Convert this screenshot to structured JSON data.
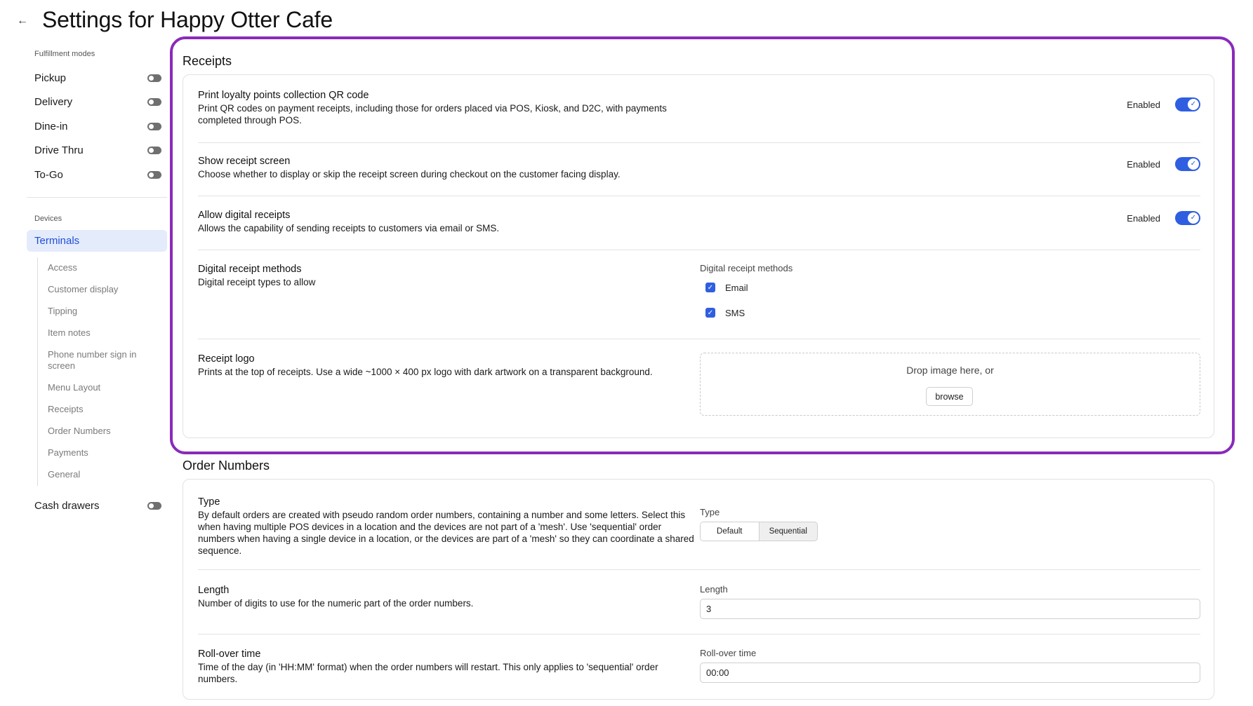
{
  "header": {
    "back_icon": "arrow-left-icon",
    "title": "Settings for Happy Otter Cafe"
  },
  "sidebar": {
    "fulfillment_label": "Fulfillment modes",
    "modes": [
      {
        "label": "Pickup"
      },
      {
        "label": "Delivery"
      },
      {
        "label": "Dine-in"
      },
      {
        "label": "Drive Thru"
      },
      {
        "label": "To-Go"
      }
    ],
    "devices_label": "Devices",
    "terminals_label": "Terminals",
    "terminal_subitems": [
      "Access",
      "Customer display",
      "Tipping",
      "Item notes",
      "Phone number sign in screen",
      "Menu Layout",
      "Receipts",
      "Order Numbers",
      "Payments",
      "General"
    ],
    "cash_drawers_label": "Cash drawers"
  },
  "receipts": {
    "title": "Receipts",
    "rows": [
      {
        "title": "Print loyalty points collection QR code",
        "desc": "Print QR codes on payment receipts, including those for orders placed via POS, Kiosk, and D2C, with payments completed through POS.",
        "status": "Enabled"
      },
      {
        "title": "Show receipt screen",
        "desc": "Choose whether to display or skip the receipt screen during checkout on the customer facing display.",
        "status": "Enabled"
      },
      {
        "title": "Allow digital receipts",
        "desc": "Allows the capability of sending receipts to customers via email or SMS.",
        "status": "Enabled"
      }
    ],
    "methods": {
      "title": "Digital receipt methods",
      "desc": "Digital receipt types to allow",
      "field_label": "Digital receipt methods",
      "options": [
        "Email",
        "SMS"
      ]
    },
    "logo": {
      "title": "Receipt logo",
      "desc": "Prints at the top of receipts. Use a wide ~1000 × 400 px logo with dark artwork on a transparent background.",
      "drop_text": "Drop image here, or",
      "browse_label": "browse"
    }
  },
  "order_numbers": {
    "title": "Order Numbers",
    "type": {
      "title": "Type",
      "desc": "By default orders are created with pseudo random order numbers, containing a number and some letters. Select this when having multiple POS devices in a location and the devices are not part of a 'mesh'. Use 'sequential' order numbers when having a single device in a location, or the devices are part of a 'mesh' so they can coordinate a shared sequence.",
      "field_label": "Type",
      "options": [
        "Default",
        "Sequential"
      ],
      "selected": "Default"
    },
    "length": {
      "title": "Length",
      "desc": "Number of digits to use for the numeric part of the order numbers.",
      "field_label": "Length",
      "value": "3"
    },
    "rollover": {
      "title": "Roll-over time",
      "desc": "Time of the day (in 'HH:MM' format) when the order numbers will restart. This only applies to 'sequential' order numbers.",
      "field_label": "Roll-over time",
      "value": "00:00"
    }
  },
  "colors": {
    "accent": "#2f5fe0",
    "highlight_border": "#8a2aba",
    "active_nav_bg": "#e4ebfb"
  }
}
